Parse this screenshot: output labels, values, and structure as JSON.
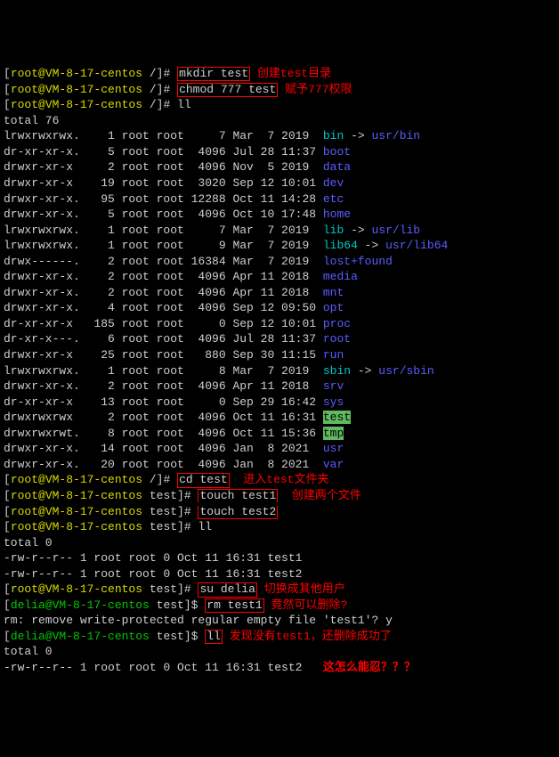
{
  "prompt_root": "[root@VM-8-17-centos /]# ",
  "prompt_root_test": "[root@VM-8-17-centos test]# ",
  "prompt_delia_test": "[delia@VM-8-17-centos test]$ ",
  "cmd1": "mkdir test",
  "ann1": "创建test目录",
  "cmd2": "chmod 777 test",
  "ann2": "赋予777权限",
  "cmd3": "ll",
  "total1": "total 76",
  "listing": [
    {
      "perm": "lrwxrwxrwx.",
      "links": "1",
      "owner": "root",
      "group": "root",
      "size": "7",
      "month": "Mar",
      "day": "7",
      "time": "2019",
      "name": "bin",
      "link": " -> usr/bin",
      "color": "c"
    },
    {
      "perm": "dr-xr-xr-x.",
      "links": "5",
      "owner": "root",
      "group": "root",
      "size": "4096",
      "month": "Jul",
      "day": "28",
      "time": "11:37",
      "name": "boot",
      "color": "bl"
    },
    {
      "perm": "drwxr-xr-x",
      "links": "2",
      "owner": "root",
      "group": "root",
      "size": "4096",
      "month": "Nov",
      "day": "5",
      "time": "2019",
      "name": "data",
      "color": "bl"
    },
    {
      "perm": "drwxr-xr-x",
      "links": "19",
      "owner": "root",
      "group": "root",
      "size": "3020",
      "month": "Sep",
      "day": "12",
      "time": "10:01",
      "name": "dev",
      "color": "bl"
    },
    {
      "perm": "drwxr-xr-x.",
      "links": "95",
      "owner": "root",
      "group": "root",
      "size": "12288",
      "month": "Oct",
      "day": "11",
      "time": "14:28",
      "name": "etc",
      "color": "bl"
    },
    {
      "perm": "drwxr-xr-x.",
      "links": "5",
      "owner": "root",
      "group": "root",
      "size": "4096",
      "month": "Oct",
      "day": "10",
      "time": "17:48",
      "name": "home",
      "color": "bl"
    },
    {
      "perm": "lrwxrwxrwx.",
      "links": "1",
      "owner": "root",
      "group": "root",
      "size": "7",
      "month": "Mar",
      "day": "7",
      "time": "2019",
      "name": "lib",
      "link": " -> usr/lib",
      "color": "c"
    },
    {
      "perm": "lrwxrwxrwx.",
      "links": "1",
      "owner": "root",
      "group": "root",
      "size": "9",
      "month": "Mar",
      "day": "7",
      "time": "2019",
      "name": "lib64",
      "link": " -> usr/lib64",
      "color": "c"
    },
    {
      "perm": "drwx------.",
      "links": "2",
      "owner": "root",
      "group": "root",
      "size": "16384",
      "month": "Mar",
      "day": "7",
      "time": "2019",
      "name": "lost+found",
      "color": "bl"
    },
    {
      "perm": "drwxr-xr-x.",
      "links": "2",
      "owner": "root",
      "group": "root",
      "size": "4096",
      "month": "Apr",
      "day": "11",
      "time": "2018",
      "name": "media",
      "color": "bl"
    },
    {
      "perm": "drwxr-xr-x.",
      "links": "2",
      "owner": "root",
      "group": "root",
      "size": "4096",
      "month": "Apr",
      "day": "11",
      "time": "2018",
      "name": "mnt",
      "color": "bl"
    },
    {
      "perm": "drwxr-xr-x.",
      "links": "4",
      "owner": "root",
      "group": "root",
      "size": "4096",
      "month": "Sep",
      "day": "12",
      "time": "09:50",
      "name": "opt",
      "color": "bl"
    },
    {
      "perm": "dr-xr-xr-x",
      "links": "185",
      "owner": "root",
      "group": "root",
      "size": "0",
      "month": "Sep",
      "day": "12",
      "time": "10:01",
      "name": "proc",
      "color": "bl"
    },
    {
      "perm": "dr-xr-x---.",
      "links": "6",
      "owner": "root",
      "group": "root",
      "size": "4096",
      "month": "Jul",
      "day": "28",
      "time": "11:37",
      "name": "root",
      "color": "bl"
    },
    {
      "perm": "drwxr-xr-x",
      "links": "25",
      "owner": "root",
      "group": "root",
      "size": "880",
      "month": "Sep",
      "day": "30",
      "time": "11:15",
      "name": "run",
      "color": "bl"
    },
    {
      "perm": "lrwxrwxrwx.",
      "links": "1",
      "owner": "root",
      "group": "root",
      "size": "8",
      "month": "Mar",
      "day": "7",
      "time": "2019",
      "name": "sbin",
      "link": " -> usr/sbin",
      "color": "c"
    },
    {
      "perm": "drwxr-xr-x.",
      "links": "2",
      "owner": "root",
      "group": "root",
      "size": "4096",
      "month": "Apr",
      "day": "11",
      "time": "2018",
      "name": "srv",
      "color": "bl"
    },
    {
      "perm": "dr-xr-xr-x",
      "links": "13",
      "owner": "root",
      "group": "root",
      "size": "0",
      "month": "Sep",
      "day": "29",
      "time": "16:42",
      "name": "sys",
      "color": "bl"
    },
    {
      "perm": "drwxrwxrwx",
      "links": "2",
      "owner": "root",
      "group": "root",
      "size": "4096",
      "month": "Oct",
      "day": "11",
      "time": "16:31",
      "name": "test",
      "color": "hl"
    },
    {
      "perm": "drwxrwxrwt.",
      "links": "8",
      "owner": "root",
      "group": "root",
      "size": "4096",
      "month": "Oct",
      "day": "11",
      "time": "15:36",
      "name": "tmp",
      "color": "hl"
    },
    {
      "perm": "drwxr-xr-x.",
      "links": "14",
      "owner": "root",
      "group": "root",
      "size": "4096",
      "month": "Jan",
      "day": "8",
      "time": "2021",
      "name": "usr",
      "color": "bl"
    },
    {
      "perm": "drwxr-xr-x.",
      "links": "20",
      "owner": "root",
      "group": "root",
      "size": "4096",
      "month": "Jan",
      "day": "8",
      "time": "2021",
      "name": "var",
      "color": "bl"
    }
  ],
  "cmd4": "cd test",
  "ann4": "进入test文件夹",
  "cmd5": "touch test1",
  "cmd6": "touch test2",
  "ann56": "创建两个文件",
  "cmd7": "ll",
  "total2": "total 0",
  "file1": "-rw-r--r-- 1 root root 0 Oct 11 16:31 test1",
  "file2": "-rw-r--r-- 1 root root 0 Oct 11 16:31 test2",
  "cmd8": "su delia",
  "ann8": "切换成其他用户",
  "cmd9": "rm test1",
  "ann9": "竟然可以删除?",
  "rmline": "rm: remove write-protected regular empty file 'test1'? y",
  "cmd10": "ll",
  "ann10": "发现没有test1，还删除成功了",
  "total3": "total 0",
  "file3": "-rw-r--r-- 1 root root 0 Oct 11 16:31 test2",
  "ann11": "这怎么能忍？？？"
}
